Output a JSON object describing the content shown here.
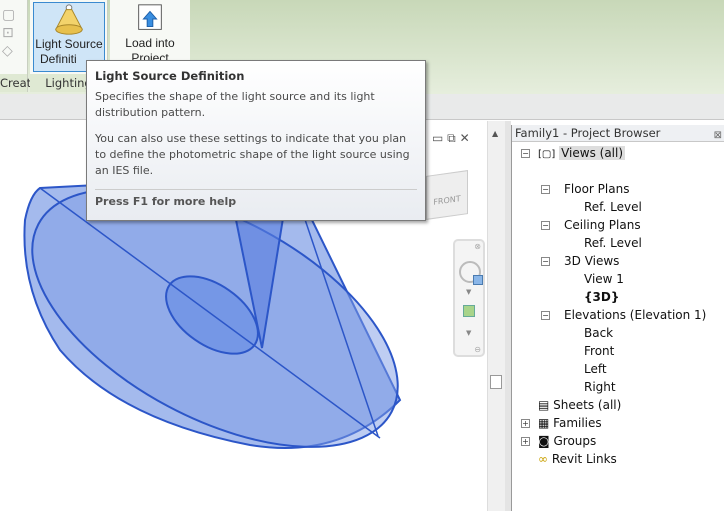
{
  "ribbon": {
    "create_panel_label": "Create",
    "lighting_panel_label": "Lighting",
    "light_source_button": "Light Source Definition",
    "light_source_button_line1": "Light Source",
    "light_source_button_line2": "Definiti",
    "load_into_button_line1": "Load into",
    "load_into_button_line2": "Project"
  },
  "tooltip": {
    "title": "Light Source Definition",
    "desc1": "Specifies the shape of the light source and its light distribution pattern.",
    "desc2": "You can also use these settings to indicate that you plan to define the photometric shape of the light source using an IES file.",
    "help": "Press F1 for more help"
  },
  "viewcube": {
    "face": "FRONT"
  },
  "project_browser": {
    "title": "Family1 - Project Browser",
    "items": [
      {
        "label": "Views (all)"
      },
      {
        "label": "Floor Plans"
      },
      {
        "label": "Ref. Level"
      },
      {
        "label": "Ceiling Plans"
      },
      {
        "label": "Ref. Level"
      },
      {
        "label": "3D Views"
      },
      {
        "label": "View 1"
      },
      {
        "label": "{3D}"
      },
      {
        "label": "Elevations (Elevation 1)"
      },
      {
        "label": "Back"
      },
      {
        "label": "Front"
      },
      {
        "label": "Left"
      },
      {
        "label": "Right"
      },
      {
        "label": "Sheets (all)"
      },
      {
        "label": "Families"
      },
      {
        "label": "Groups"
      },
      {
        "label": "Revit Links"
      }
    ]
  }
}
